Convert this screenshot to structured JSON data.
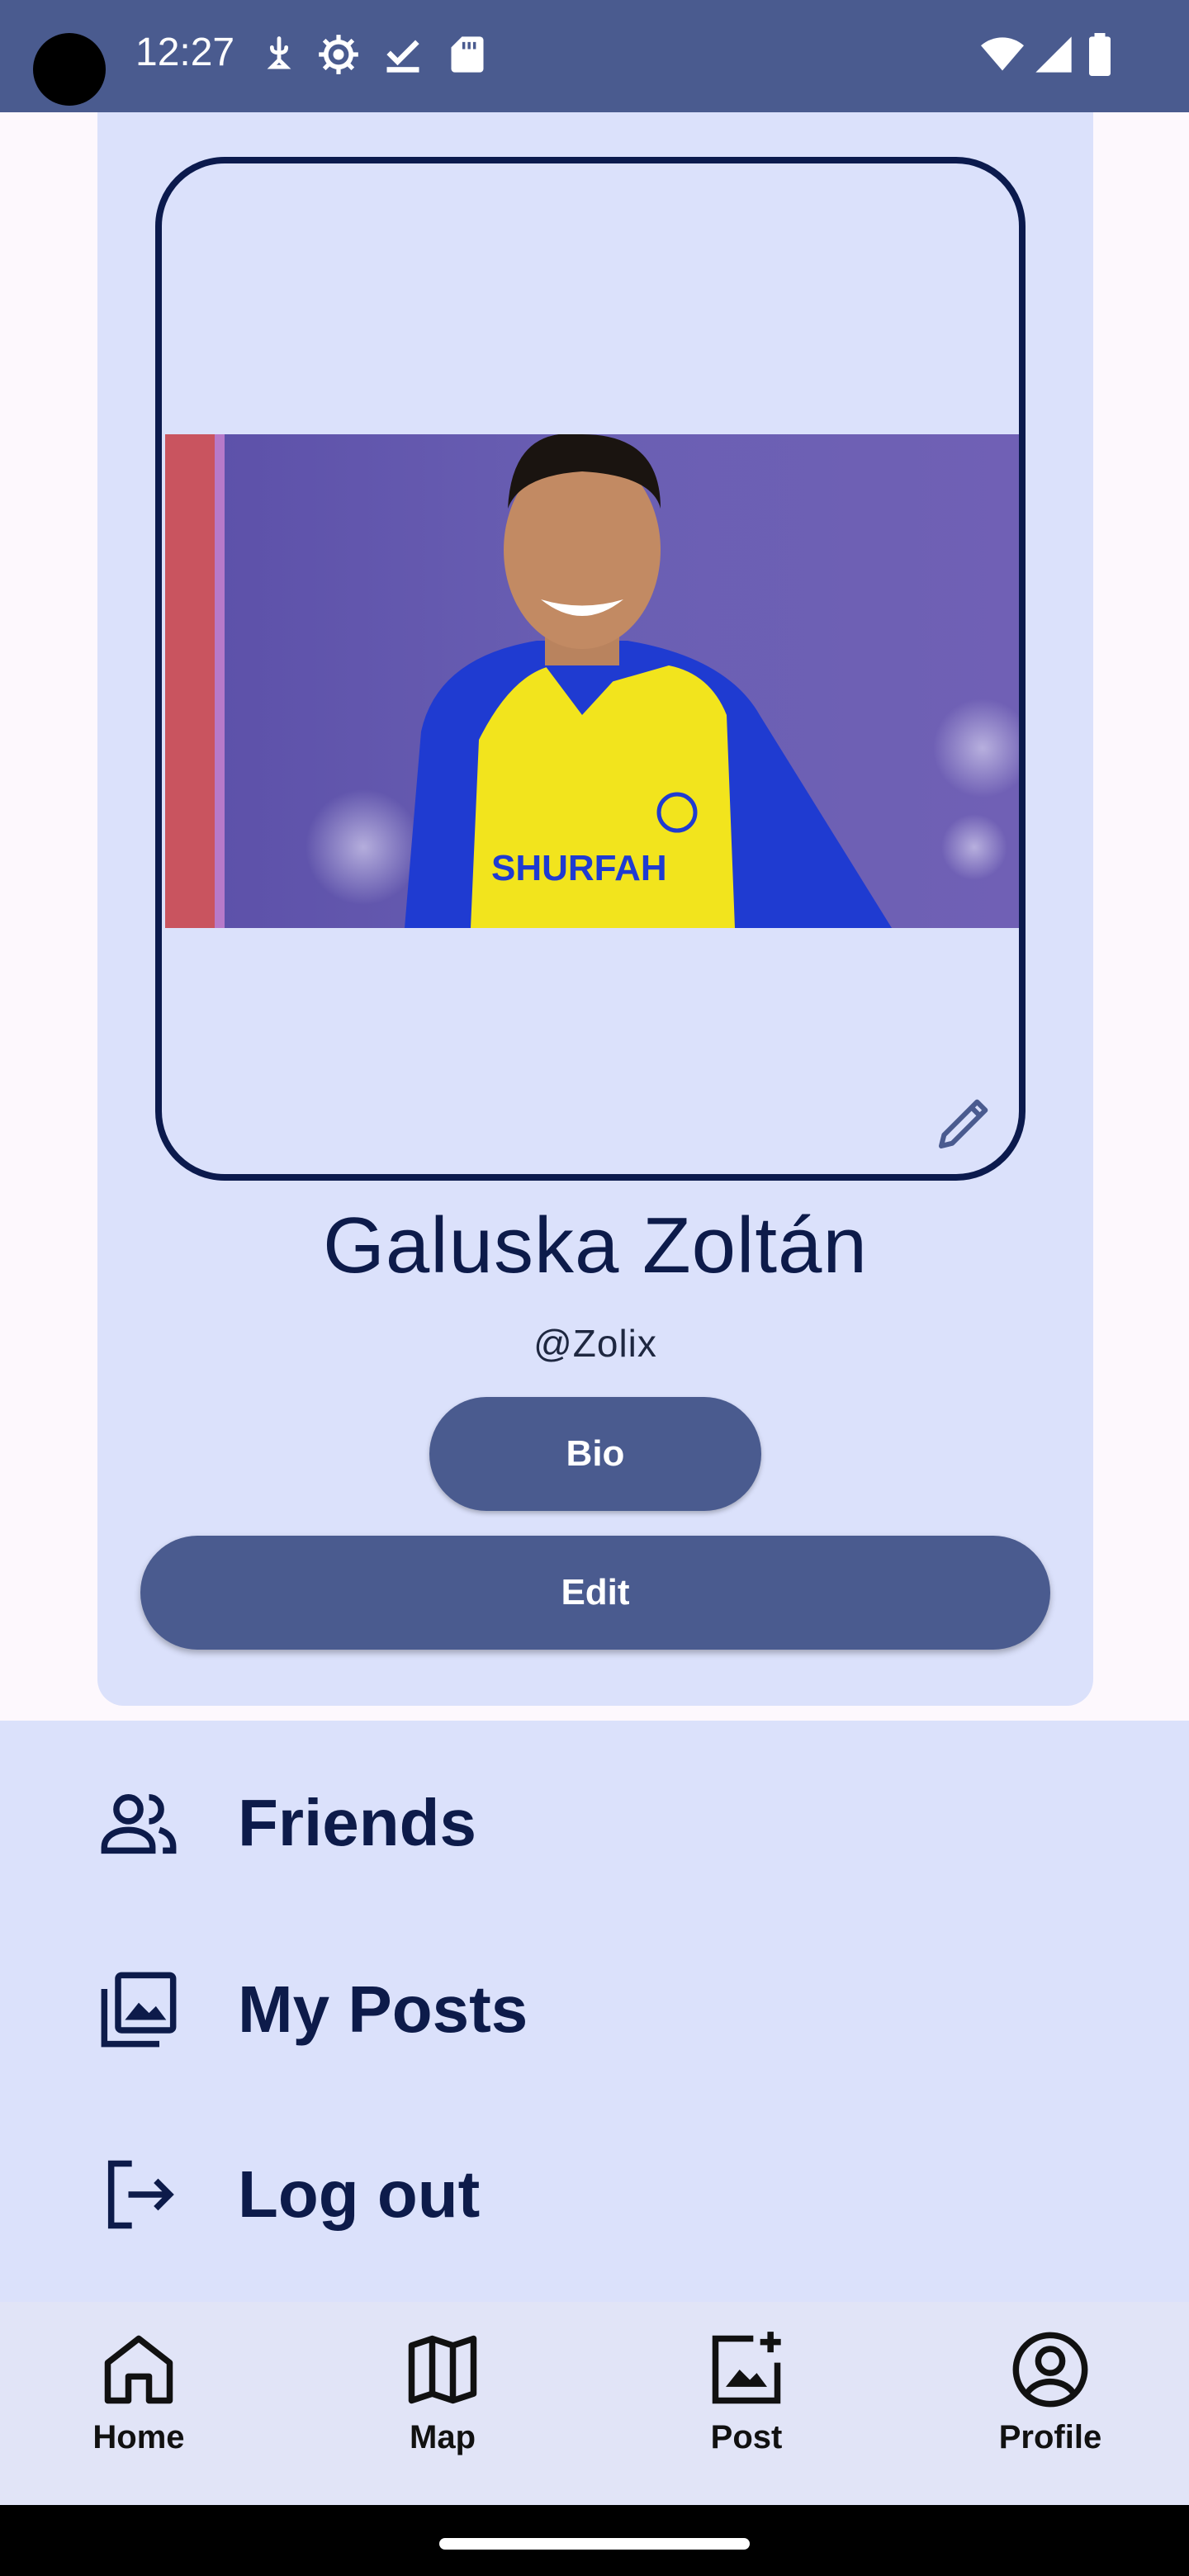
{
  "status_bar": {
    "time": "12:27",
    "icons": [
      "camera-cutout",
      "usb-debug-icon",
      "settings-icon",
      "download-done-icon",
      "sd-card-icon",
      "wifi-icon",
      "signal-icon",
      "battery-icon"
    ]
  },
  "profile": {
    "name": "Galuska Zoltán",
    "handle": "@Zolix",
    "photo_caption_text": "SHURFAH",
    "bio_label": "Bio",
    "edit_label": "Edit"
  },
  "menu": {
    "items": [
      {
        "label": "Friends",
        "icon": "people-icon"
      },
      {
        "label": "My Posts",
        "icon": "photo-library-icon"
      },
      {
        "label": "Log out",
        "icon": "logout-icon"
      }
    ]
  },
  "bottom_nav": {
    "items": [
      {
        "label": "Home",
        "icon": "home-icon"
      },
      {
        "label": "Map",
        "icon": "map-icon"
      },
      {
        "label": "Post",
        "icon": "add-photo-icon"
      },
      {
        "label": "Profile",
        "icon": "profile-icon"
      }
    ]
  },
  "colors": {
    "primary": "#4a5b8f",
    "surface_container": "#dbe1fb",
    "nav_background": "#e1e4f7",
    "on_surface": "#0d1b4a"
  }
}
